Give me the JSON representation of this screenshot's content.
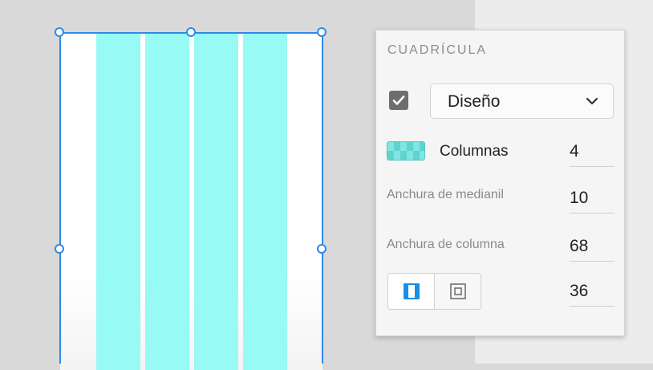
{
  "panel": {
    "title": "CUADRÍCULA",
    "grid_enabled": true,
    "grid_type": "Diseño",
    "columns_label": "Columnas",
    "columns_value": "4",
    "gutter_label": "Anchura de medianil",
    "gutter_value": "10",
    "column_width_label": "Anchura de columna",
    "column_width_value": "68",
    "margin_value": "36",
    "margin_mode_selected": "linked-sides"
  },
  "colors": {
    "grid_column": "#97faf5",
    "selection": "#2f8ae6"
  },
  "icons": {
    "checkbox": "checkmark-icon",
    "dropdown": "chevron-down-icon",
    "grid_swatch": "grid-swatch-icon",
    "margin_sides": "margin-sides-icon",
    "margin_all": "margin-all-icon"
  }
}
